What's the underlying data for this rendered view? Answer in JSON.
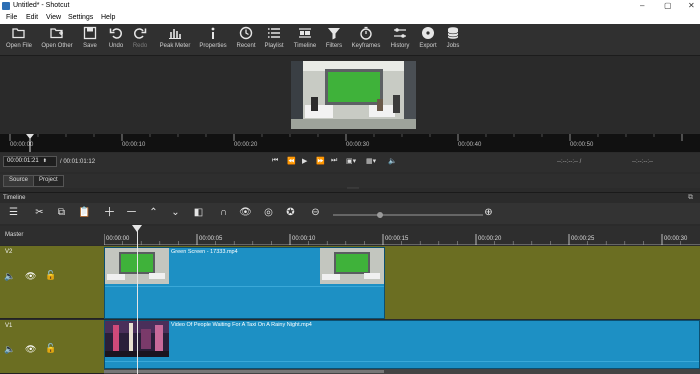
{
  "window": {
    "title": "Untitled* - Shotcut",
    "controls": [
      "–",
      "▢",
      "✕"
    ]
  },
  "menu": [
    "File",
    "Edit",
    "View",
    "Settings",
    "Help"
  ],
  "toolbar": [
    {
      "label": "Open File",
      "icon": "folder-open-icon"
    },
    {
      "label": "Open Other",
      "icon": "open-other-icon"
    },
    {
      "label": "Save",
      "icon": "save-icon"
    },
    {
      "label": "Undo",
      "icon": "undo-icon"
    },
    {
      "label": "Redo",
      "icon": "redo-icon"
    },
    {
      "label": "Peak Meter",
      "icon": "peak-meter-icon"
    },
    {
      "label": "Properties",
      "icon": "properties-icon"
    },
    {
      "label": "Recent",
      "icon": "recent-icon"
    },
    {
      "label": "Playlist",
      "icon": "playlist-icon"
    },
    {
      "label": "Timeline",
      "icon": "timeline-icon"
    },
    {
      "label": "Filters",
      "icon": "filters-icon"
    },
    {
      "label": "Keyframes",
      "icon": "keyframes-icon"
    },
    {
      "label": "History",
      "icon": "history-icon"
    },
    {
      "label": "Export",
      "icon": "export-icon"
    },
    {
      "label": "Jobs",
      "icon": "jobs-icon"
    }
  ],
  "player_ruler": [
    "00:00:00",
    "00:00:10",
    "00:00:20",
    "00:00:30",
    "00:00:40",
    "00:00:50"
  ],
  "transport": {
    "current_time": "00:00:01:21",
    "duration": "/ 00:01:01:12",
    "in_point": "--:--:--:-- /",
    "out_point": "--:--:--:--"
  },
  "tabs": {
    "source": "Source",
    "project": "Project"
  },
  "timeline": {
    "title": "Timeline",
    "master_label": "Master",
    "ruler": [
      "00:00:00",
      "00:00:05",
      "00:00:10",
      "00:00:15",
      "00:00:20",
      "00:00:25",
      "00:00:30"
    ],
    "tracks": [
      {
        "name": "V2",
        "clip": "Green Screen - 17333.mp4"
      },
      {
        "name": "V1",
        "clip": "Video Of People Waiting For A Taxi On A Rainy Night.mp4"
      }
    ],
    "track_color": "#6b6e22",
    "clip_color": "#1d90c4"
  }
}
